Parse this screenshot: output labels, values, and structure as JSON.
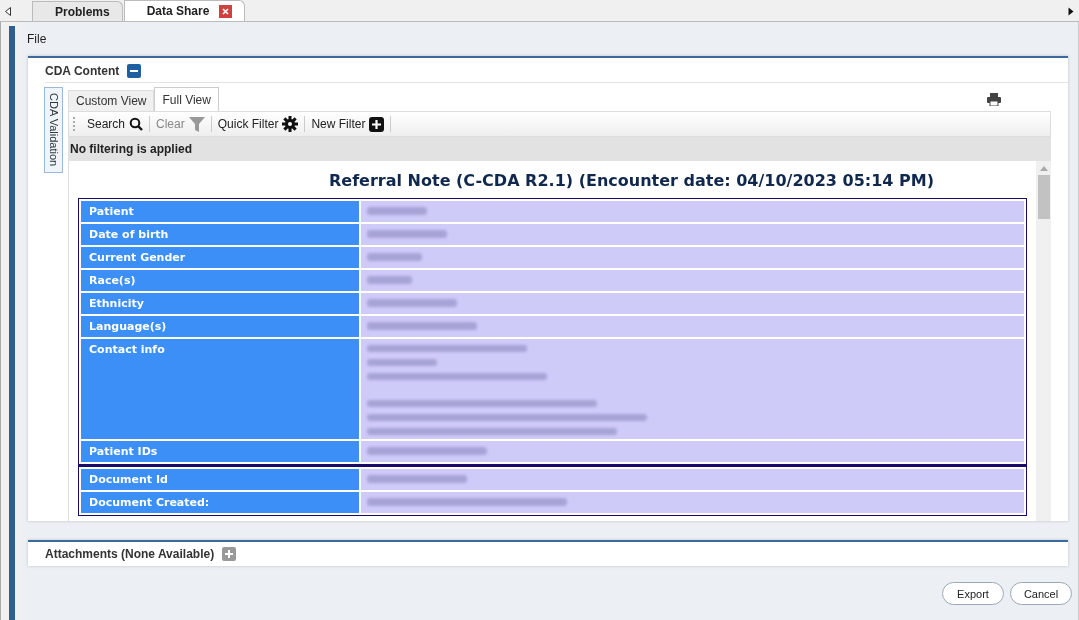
{
  "tabs": [
    {
      "label": "Problems",
      "selected": false,
      "closable": false
    },
    {
      "label": "Data Share",
      "selected": true,
      "closable": true
    }
  ],
  "menu": [
    "File"
  ],
  "cda_panel": {
    "title": "CDA Content",
    "expanded": true,
    "side_tab": "CDA Validation",
    "view_tabs": [
      {
        "label": "Custom View",
        "selected": false
      },
      {
        "label": "Full View",
        "selected": true
      }
    ],
    "toolbar": [
      {
        "label": "Search",
        "kind": "search",
        "disabled": false
      },
      {
        "label": "Clear",
        "kind": "filter",
        "disabled": true
      },
      {
        "label": "Quick Filter",
        "kind": "gear",
        "disabled": false
      },
      {
        "label": "New Filter",
        "kind": "plus",
        "disabled": false
      }
    ],
    "filter_status": "No filtering is applied",
    "document": {
      "title": "Referral Note (C-CDA R2.1) (Encounter date: 04/10/2023 05:14 PM)",
      "tables": [
        {
          "rows": [
            {
              "label": "Patient",
              "kind": "short"
            },
            {
              "label": "Date of birth",
              "kind": "short"
            },
            {
              "label": "Current Gender",
              "kind": "short"
            },
            {
              "label": "Race(s)",
              "kind": "short"
            },
            {
              "label": "Ethnicity",
              "kind": "short"
            },
            {
              "label": "Language(s)",
              "kind": "short"
            },
            {
              "label": "Contact info",
              "kind": "long"
            },
            {
              "label": "Patient IDs",
              "kind": "short"
            }
          ]
        },
        {
          "rows": [
            {
              "label": "Document Id",
              "kind": "short"
            },
            {
              "label": "Document Created:",
              "kind": "short"
            }
          ]
        }
      ]
    }
  },
  "attachments_panel": {
    "title": "Attachments (None Available)",
    "expanded": false
  },
  "buttons": [
    "Export",
    "Cancel"
  ]
}
